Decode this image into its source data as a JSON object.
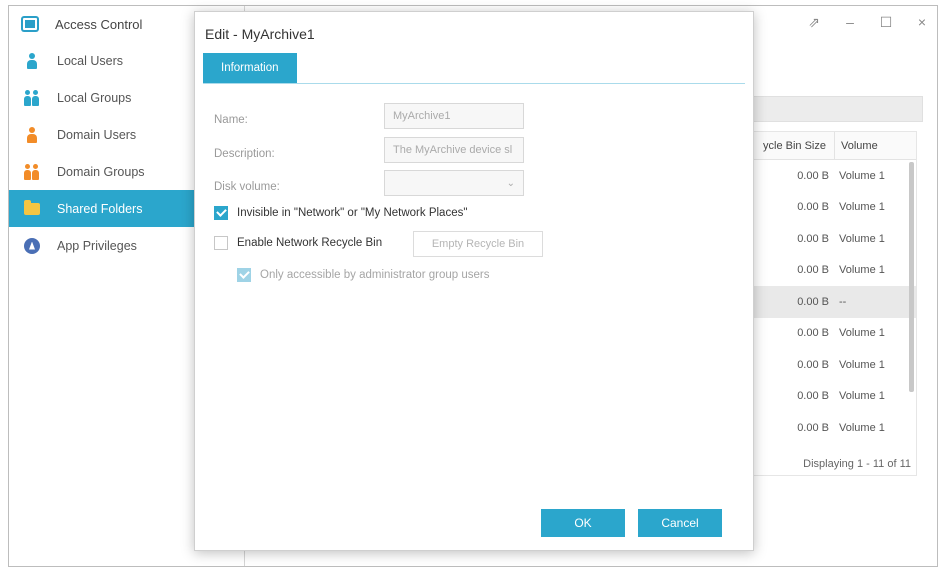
{
  "app": {
    "title": "Access Control",
    "window_controls": [
      "⇗",
      "–",
      "☐",
      "×"
    ]
  },
  "sidebar": {
    "items": [
      {
        "label": "Local Users",
        "icon": "user-icon"
      },
      {
        "label": "Local Groups",
        "icon": "group-icon"
      },
      {
        "label": "Domain Users",
        "icon": "domain-user-icon"
      },
      {
        "label": "Domain Groups",
        "icon": "domain-group-icon"
      },
      {
        "label": "Shared Folders",
        "icon": "folder-icon",
        "active": true
      },
      {
        "label": "App Privileges",
        "icon": "privilege-icon"
      }
    ]
  },
  "grid": {
    "columns": [
      "ycle Bin Size",
      "Volume"
    ],
    "rows": [
      {
        "size": "0.00 B",
        "volume": "Volume 1"
      },
      {
        "size": "0.00 B",
        "volume": "Volume 1"
      },
      {
        "size": "0.00 B",
        "volume": "Volume 1"
      },
      {
        "size": "0.00 B",
        "volume": "Volume 1"
      },
      {
        "size": "0.00 B",
        "volume": "--"
      },
      {
        "size": "0.00 B",
        "volume": "Volume 1"
      },
      {
        "size": "0.00 B",
        "volume": "Volume 1"
      },
      {
        "size": "0.00 B",
        "volume": "Volume 1"
      },
      {
        "size": "0.00 B",
        "volume": "Volume 1"
      }
    ],
    "footer": "Displaying 1 - 11 of 11"
  },
  "dialog": {
    "title": "Edit - MyArchive1",
    "tab": "Information",
    "name_label": "Name:",
    "name_value": "MyArchive1",
    "description_label": "Description:",
    "description_value": "The MyArchive device sl",
    "disk_label": "Disk volume:",
    "disk_value": "",
    "invisible_label": "Invisible in \"Network\" or \"My Network Places\"",
    "recycle_label": "Enable Network Recycle Bin",
    "empty_recycle_label": "Empty Recycle Bin",
    "admin_only_label": "Only accessible by administrator group users",
    "ok_label": "OK",
    "cancel_label": "Cancel"
  },
  "colors": {
    "accent": "#2ba6cc",
    "orange": "#f28c28",
    "folder": "#f5c542"
  }
}
